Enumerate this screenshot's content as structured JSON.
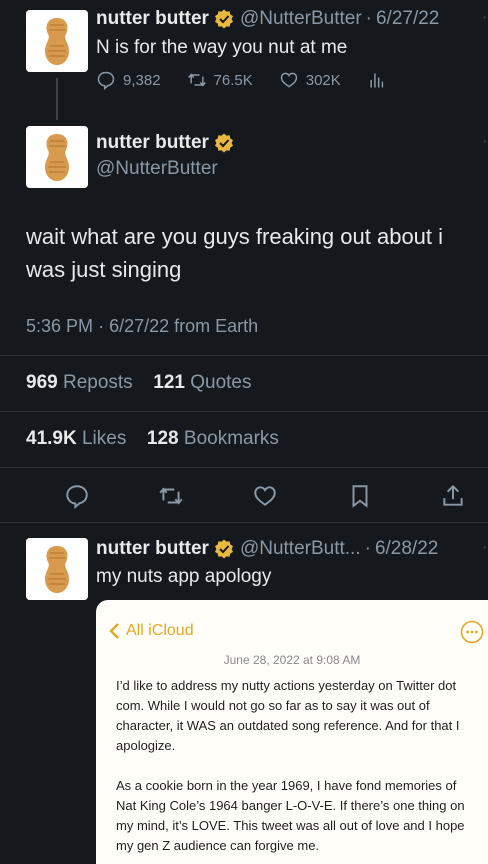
{
  "tweet1": {
    "name": "nutter butter",
    "handle": "@NutterButter",
    "date": "6/27/22",
    "text": "N is for the way you nut at me",
    "replies": "9,382",
    "reposts": "76.5K",
    "likes": "302K"
  },
  "main_tweet": {
    "name": "nutter butter",
    "handle": "@NutterButter",
    "text": "wait what are you guys freaking out about i was just singing",
    "time": "5:36 PM",
    "date": "6/27/22",
    "source": "from Earth",
    "reposts_count": "969",
    "reposts_label": "Reposts",
    "quotes_count": "121",
    "quotes_label": "Quotes",
    "likes_count": "41.9K",
    "likes_label": "Likes",
    "bookmarks_count": "128",
    "bookmarks_label": "Bookmarks"
  },
  "tweet3": {
    "name": "nutter butter",
    "handle": "@NutterButt...",
    "date": "6/28/22",
    "text": "my nuts app apology"
  },
  "note": {
    "back_label": "All iCloud",
    "date": "June 28, 2022 at 9:08 AM",
    "paragraph1": "I’d like to address my nutty actions yesterday on Twitter dot com. While I would not go so far as to say it was out of character, it WAS an outdated song reference. And for that I apologize.",
    "paragraph2": "As a cookie born in the year 1969, I have fond memories of Nat King Cole’s 1964 banger L-O-V-E. If there’s one thing on my mind, it’s LOVE. This tweet was all out of love and I hope my gen Z audience can forgive me."
  },
  "colors": {
    "background": "#15181d",
    "text": "#e7e9ea",
    "muted": "#8b98a5",
    "verified": "#e8b93e",
    "notes_accent": "#e1a824"
  }
}
